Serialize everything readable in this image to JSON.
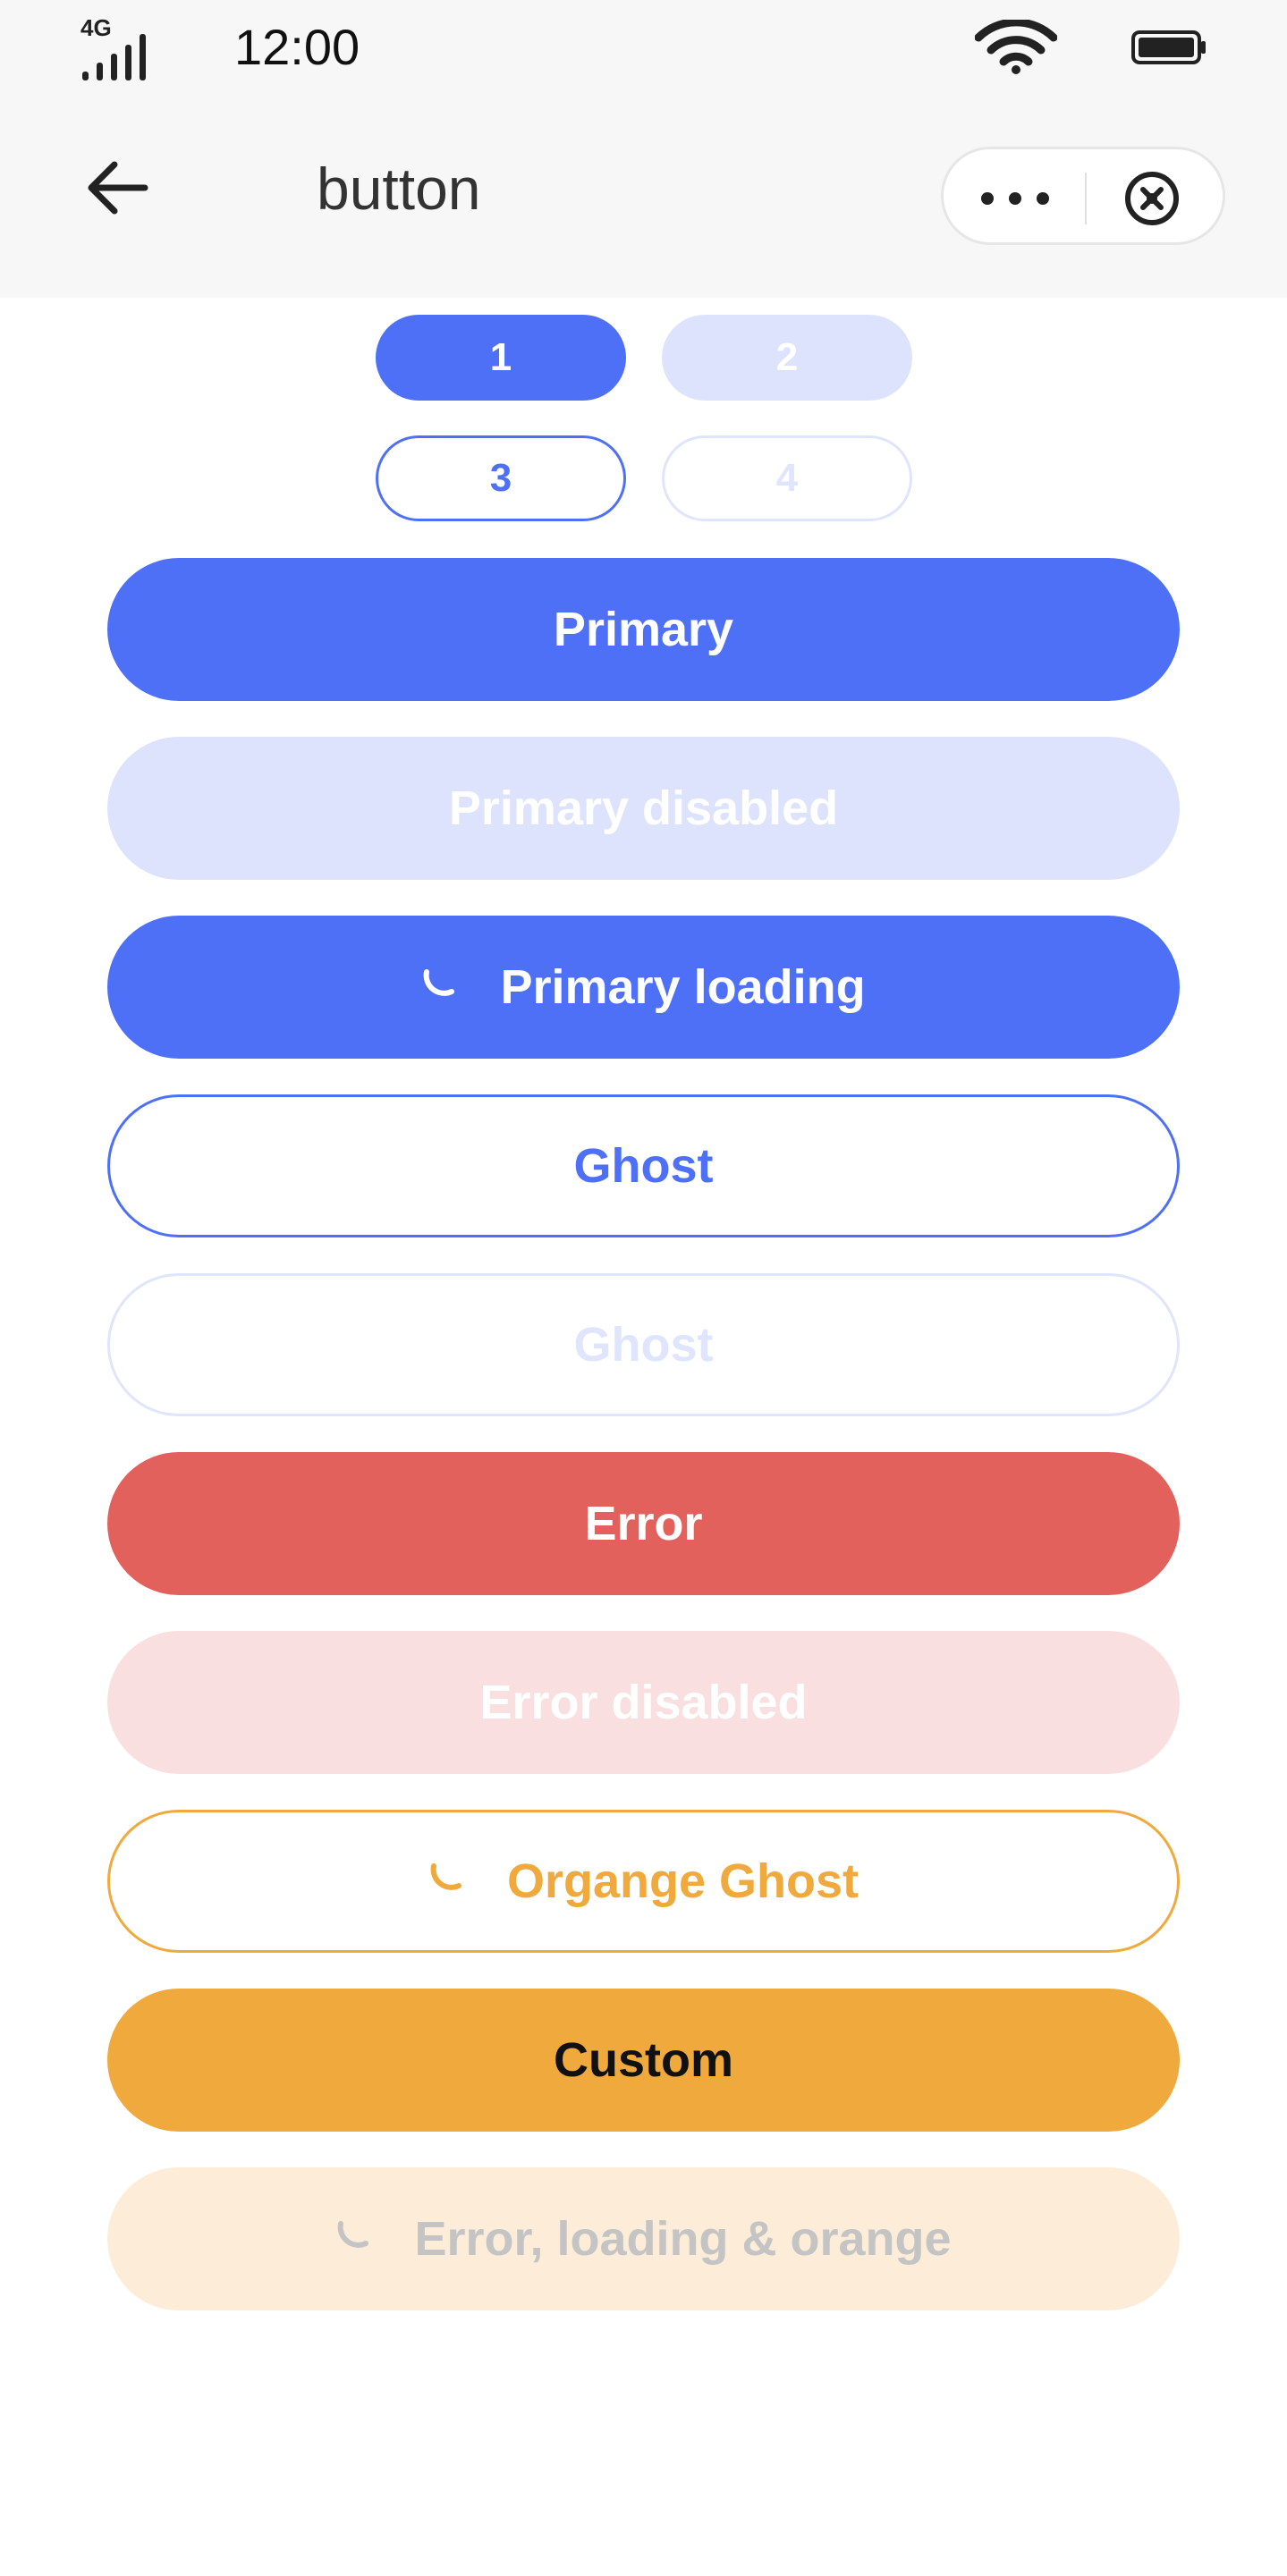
{
  "status_bar": {
    "network": "4G",
    "time": "12:00"
  },
  "nav_bar": {
    "title": "button",
    "back_icon": "arrow-left-icon",
    "more_icon": "more-dots-icon",
    "close_icon": "close-circle-icon"
  },
  "small_buttons": [
    {
      "label": "1",
      "variant": "primary"
    },
    {
      "label": "2",
      "variant": "primary-disabled"
    },
    {
      "label": "3",
      "variant": "ghost"
    },
    {
      "label": "4",
      "variant": "ghost-disabled"
    }
  ],
  "buttons": [
    {
      "label": "Primary",
      "variant": "primary",
      "loading": false
    },
    {
      "label": "Primary disabled",
      "variant": "primary-disabled",
      "loading": false
    },
    {
      "label": "Primary loading",
      "variant": "primary",
      "loading": true
    },
    {
      "label": "Ghost",
      "variant": "ghost",
      "loading": false
    },
    {
      "label": "Ghost",
      "variant": "ghost-disabled",
      "loading": false
    },
    {
      "label": "Error",
      "variant": "error",
      "loading": false
    },
    {
      "label": "Error disabled",
      "variant": "error-disabled",
      "loading": false
    },
    {
      "label": "Organge Ghost",
      "variant": "orange-ghost",
      "loading": true
    },
    {
      "label": "Custom",
      "variant": "custom",
      "loading": false
    },
    {
      "label": "Error, loading & orange",
      "variant": "orange-disabled",
      "loading": true
    }
  ],
  "colors": {
    "primary": "#4e70f6",
    "primary_disabled": "#dde3fd",
    "error": "#e3615c",
    "error_disabled": "#f9dfdf",
    "orange": "#f0a93c",
    "orange_disabled": "#fcecd8",
    "navbar_background": "#f7f7f7"
  }
}
